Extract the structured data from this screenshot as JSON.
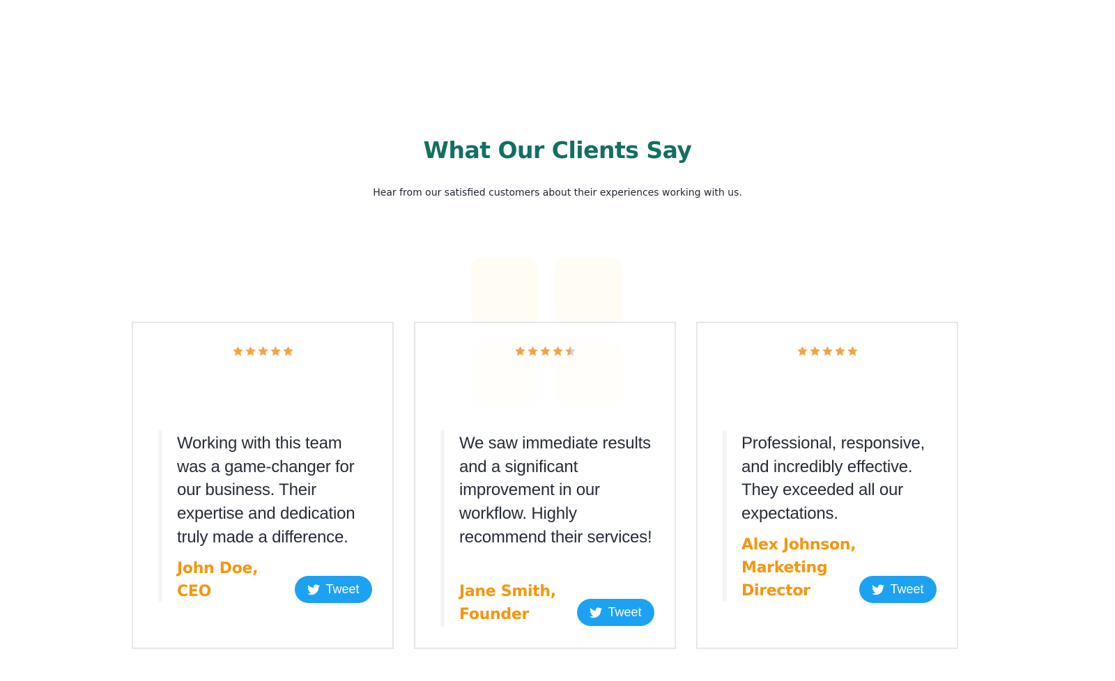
{
  "section": {
    "title": "What Our Clients Say",
    "subtitle": "Hear from our satisfied customers about their experiences working with us."
  },
  "colors": {
    "title": "#136f63",
    "author": "#f5960c",
    "star_filled": "#f4a446",
    "star_empty": "#c9d2dc",
    "tweet_button": "#1da1f2"
  },
  "testimonials": [
    {
      "rating": 5,
      "quote": "Working with this team was a game-changer for our business. Their expertise and dedication truly made a difference.",
      "author": "John Doe, CEO",
      "tweet_label": "Tweet",
      "tweet_icon": "twitter-bird-icon"
    },
    {
      "rating": 4.5,
      "quote": "We saw immediate results and a significant improvement in our workflow. Highly recommend their services!",
      "author": "Jane Smith, Founder",
      "tweet_label": "Tweet",
      "tweet_icon": "twitter-bird-icon"
    },
    {
      "rating": 5,
      "quote": "Professional, responsive, and incredibly effective. They exceeded all our expectations.",
      "author": "Alex Johnson, Marketing Director",
      "tweet_label": "Tweet",
      "tweet_icon": "twitter-bird-icon"
    }
  ]
}
